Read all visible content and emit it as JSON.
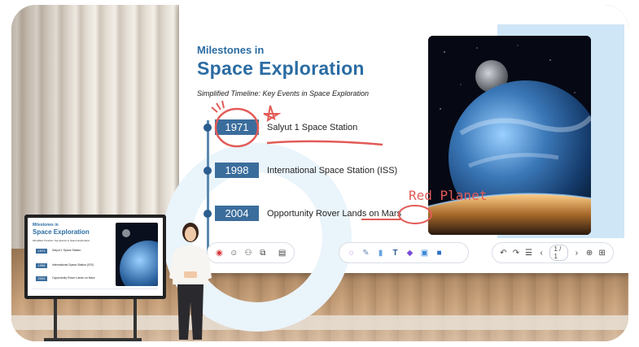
{
  "slide": {
    "title_small": "Milestones in",
    "title_big": "Space Exploration",
    "subtitle": "Simplified Timeline: Key Events in Space Exploration",
    "timeline": [
      {
        "year": "1971",
        "event": "Salyut 1 Space Station"
      },
      {
        "year": "1998",
        "event": "International Space Station (ISS)"
      },
      {
        "year": "2004",
        "event": "Opportunity Rover Lands on Mars"
      }
    ],
    "annotation": "Red Planet"
  },
  "toolbar_left": {
    "icons": [
      "record-icon",
      "add-user-icon",
      "user-switch-icon",
      "screen-share-icon",
      "clipboard-icon"
    ]
  },
  "toolbar_center": {
    "icons": [
      "lasso-icon",
      "pen-icon",
      "eraser-icon",
      "text-icon",
      "shapes-icon",
      "image-icon",
      "box-icon"
    ]
  },
  "toolbar_right": {
    "undo": "↶",
    "redo": "↷",
    "page_indicator": "1 / 1",
    "icons": [
      "undo-icon",
      "redo-icon",
      "notes-icon",
      "prev-page-icon",
      "next-page-icon",
      "add-page-icon",
      "pages-grid-icon"
    ]
  },
  "colors": {
    "accent_blue": "#2b6ca3",
    "year_box": "#3b6d9c",
    "ink_red": "#e25b57",
    "deco_blue": "#cfe6f6"
  }
}
